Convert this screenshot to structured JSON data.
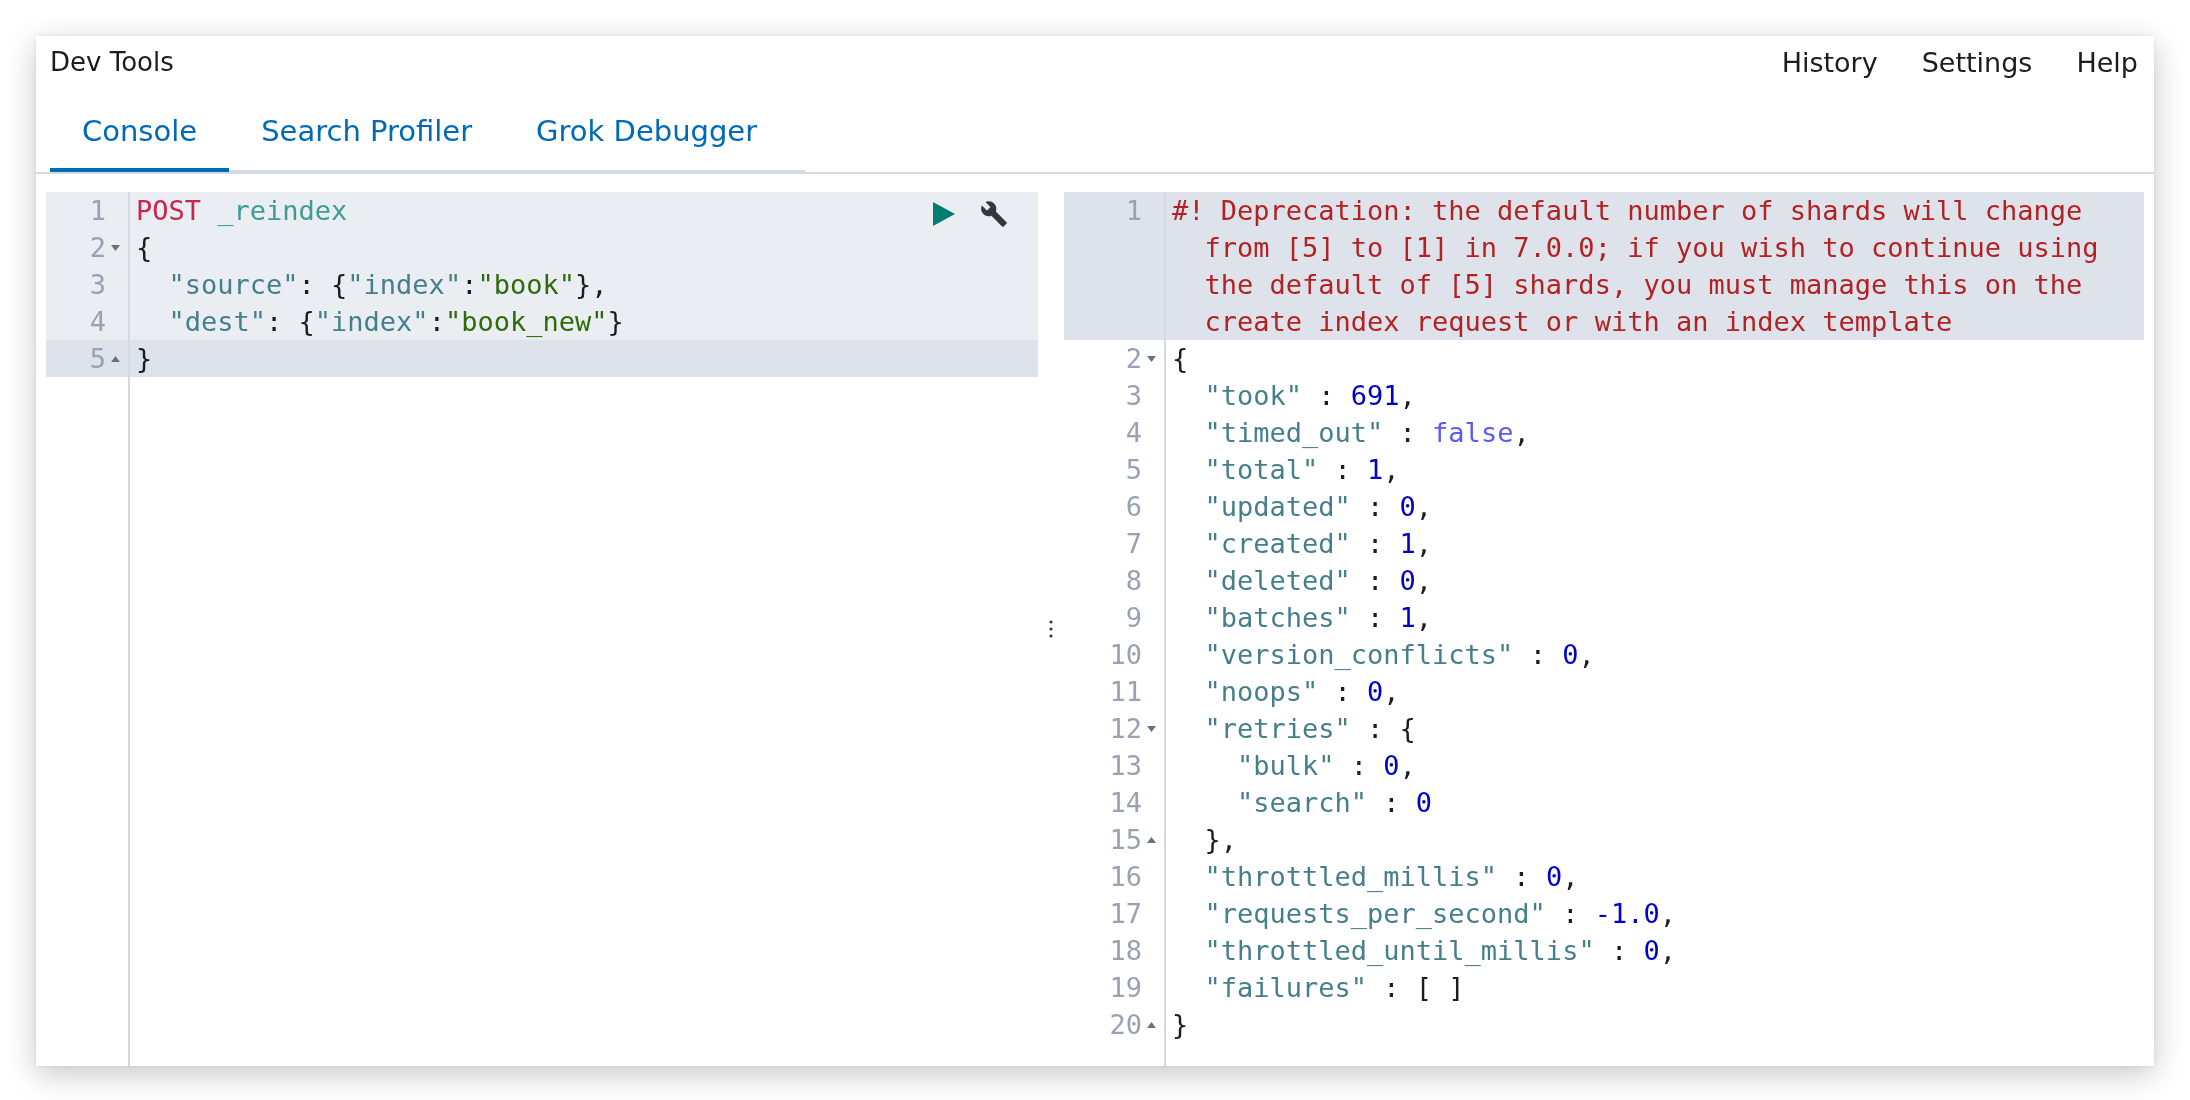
{
  "header": {
    "title": "Dev Tools",
    "links": [
      "History",
      "Settings",
      "Help"
    ]
  },
  "tabs": [
    {
      "label": "Console",
      "selected": true
    },
    {
      "label": "Search Profiler",
      "selected": false
    },
    {
      "label": "Grok Debugger",
      "selected": false
    }
  ],
  "request_editor": {
    "lines": [
      {
        "number": "1",
        "fold_start": false,
        "fold_end": false,
        "highlighted": true,
        "active": false,
        "tokens": [
          {
            "kind": "method",
            "text": "POST"
          },
          {
            "kind": "url",
            "text": " _reindex"
          }
        ]
      },
      {
        "number": "2",
        "fold_start": true,
        "fold_end": false,
        "highlighted": true,
        "active": false,
        "tokens": [
          {
            "kind": "punct",
            "text": "{"
          }
        ]
      },
      {
        "number": "3",
        "fold_start": false,
        "fold_end": false,
        "highlighted": true,
        "active": false,
        "tokens": [
          {
            "kind": "key",
            "text": "  \"source\""
          },
          {
            "kind": "punct",
            "text": ": {"
          },
          {
            "kind": "key",
            "text": "\"index\""
          },
          {
            "kind": "punct",
            "text": ":"
          },
          {
            "kind": "string",
            "text": "\"book\""
          },
          {
            "kind": "punct",
            "text": "},"
          }
        ]
      },
      {
        "number": "4",
        "fold_start": false,
        "fold_end": false,
        "highlighted": true,
        "active": false,
        "tokens": [
          {
            "kind": "key",
            "text": "  \"dest\""
          },
          {
            "kind": "punct",
            "text": ": {"
          },
          {
            "kind": "key",
            "text": "\"index\""
          },
          {
            "kind": "punct",
            "text": ":"
          },
          {
            "kind": "string",
            "text": "\"book_new\""
          },
          {
            "kind": "punct",
            "text": "}"
          }
        ]
      },
      {
        "number": "5",
        "fold_start": false,
        "fold_end": true,
        "highlighted": true,
        "active": true,
        "tokens": [
          {
            "kind": "punct",
            "text": "}"
          }
        ]
      }
    ]
  },
  "response_editor": {
    "lines": [
      {
        "number": "1",
        "fold_start": false,
        "fold_end": false,
        "active": true,
        "tokens": [
          {
            "kind": "comment",
            "text": "#! Deprecation: the default number of shards will change from [5] to [1] in 7.0.0; if you wish to continue using the default of [5] shards, you must manage this on the create index request or with an index template"
          }
        ]
      },
      {
        "number": "2",
        "fold_start": true,
        "fold_end": false,
        "active": false,
        "tokens": [
          {
            "kind": "punct",
            "text": "{"
          }
        ]
      },
      {
        "number": "3",
        "fold_start": false,
        "fold_end": false,
        "active": false,
        "tokens": [
          {
            "kind": "key",
            "text": "  \"took\""
          },
          {
            "kind": "punct",
            "text": " : "
          },
          {
            "kind": "number",
            "text": "691"
          },
          {
            "kind": "punct",
            "text": ","
          }
        ]
      },
      {
        "number": "4",
        "fold_start": false,
        "fold_end": false,
        "active": false,
        "tokens": [
          {
            "kind": "key",
            "text": "  \"timed_out\""
          },
          {
            "kind": "punct",
            "text": " : "
          },
          {
            "kind": "boolean",
            "text": "false"
          },
          {
            "kind": "punct",
            "text": ","
          }
        ]
      },
      {
        "number": "5",
        "fold_start": false,
        "fold_end": false,
        "active": false,
        "tokens": [
          {
            "kind": "key",
            "text": "  \"total\""
          },
          {
            "kind": "punct",
            "text": " : "
          },
          {
            "kind": "number",
            "text": "1"
          },
          {
            "kind": "punct",
            "text": ","
          }
        ]
      },
      {
        "number": "6",
        "fold_start": false,
        "fold_end": false,
        "active": false,
        "tokens": [
          {
            "kind": "key",
            "text": "  \"updated\""
          },
          {
            "kind": "punct",
            "text": " : "
          },
          {
            "kind": "number",
            "text": "0"
          },
          {
            "kind": "punct",
            "text": ","
          }
        ]
      },
      {
        "number": "7",
        "fold_start": false,
        "fold_end": false,
        "active": false,
        "tokens": [
          {
            "kind": "key",
            "text": "  \"created\""
          },
          {
            "kind": "punct",
            "text": " : "
          },
          {
            "kind": "number",
            "text": "1"
          },
          {
            "kind": "punct",
            "text": ","
          }
        ]
      },
      {
        "number": "8",
        "fold_start": false,
        "fold_end": false,
        "active": false,
        "tokens": [
          {
            "kind": "key",
            "text": "  \"deleted\""
          },
          {
            "kind": "punct",
            "text": " : "
          },
          {
            "kind": "number",
            "text": "0"
          },
          {
            "kind": "punct",
            "text": ","
          }
        ]
      },
      {
        "number": "9",
        "fold_start": false,
        "fold_end": false,
        "active": false,
        "tokens": [
          {
            "kind": "key",
            "text": "  \"batches\""
          },
          {
            "kind": "punct",
            "text": " : "
          },
          {
            "kind": "number",
            "text": "1"
          },
          {
            "kind": "punct",
            "text": ","
          }
        ]
      },
      {
        "number": "10",
        "fold_start": false,
        "fold_end": false,
        "active": false,
        "tokens": [
          {
            "kind": "key",
            "text": "  \"version_conflicts\""
          },
          {
            "kind": "punct",
            "text": " : "
          },
          {
            "kind": "number",
            "text": "0"
          },
          {
            "kind": "punct",
            "text": ","
          }
        ]
      },
      {
        "number": "11",
        "fold_start": false,
        "fold_end": false,
        "active": false,
        "tokens": [
          {
            "kind": "key",
            "text": "  \"noops\""
          },
          {
            "kind": "punct",
            "text": " : "
          },
          {
            "kind": "number",
            "text": "0"
          },
          {
            "kind": "punct",
            "text": ","
          }
        ]
      },
      {
        "number": "12",
        "fold_start": true,
        "fold_end": false,
        "active": false,
        "tokens": [
          {
            "kind": "key",
            "text": "  \"retries\""
          },
          {
            "kind": "punct",
            "text": " : {"
          }
        ]
      },
      {
        "number": "13",
        "fold_start": false,
        "fold_end": false,
        "active": false,
        "tokens": [
          {
            "kind": "key",
            "text": "    \"bulk\""
          },
          {
            "kind": "punct",
            "text": " : "
          },
          {
            "kind": "number",
            "text": "0"
          },
          {
            "kind": "punct",
            "text": ","
          }
        ]
      },
      {
        "number": "14",
        "fold_start": false,
        "fold_end": false,
        "active": false,
        "tokens": [
          {
            "kind": "key",
            "text": "    \"search\""
          },
          {
            "kind": "punct",
            "text": " : "
          },
          {
            "kind": "number",
            "text": "0"
          }
        ]
      },
      {
        "number": "15",
        "fold_start": false,
        "fold_end": true,
        "active": false,
        "tokens": [
          {
            "kind": "punct",
            "text": "  },"
          }
        ]
      },
      {
        "number": "16",
        "fold_start": false,
        "fold_end": false,
        "active": false,
        "tokens": [
          {
            "kind": "key",
            "text": "  \"throttled_millis\""
          },
          {
            "kind": "punct",
            "text": " : "
          },
          {
            "kind": "number",
            "text": "0"
          },
          {
            "kind": "punct",
            "text": ","
          }
        ]
      },
      {
        "number": "17",
        "fold_start": false,
        "fold_end": false,
        "active": false,
        "tokens": [
          {
            "kind": "key",
            "text": "  \"requests_per_second\""
          },
          {
            "kind": "punct",
            "text": " : "
          },
          {
            "kind": "number",
            "text": "-1.0"
          },
          {
            "kind": "punct",
            "text": ","
          }
        ]
      },
      {
        "number": "18",
        "fold_start": false,
        "fold_end": false,
        "active": false,
        "tokens": [
          {
            "kind": "key",
            "text": "  \"throttled_until_millis\""
          },
          {
            "kind": "punct",
            "text": " : "
          },
          {
            "kind": "number",
            "text": "0"
          },
          {
            "kind": "punct",
            "text": ","
          }
        ]
      },
      {
        "number": "19",
        "fold_start": false,
        "fold_end": false,
        "active": false,
        "tokens": [
          {
            "kind": "key",
            "text": "  \"failures\""
          },
          {
            "kind": "punct",
            "text": " : [ ]"
          }
        ]
      },
      {
        "number": "20",
        "fold_start": false,
        "fold_end": true,
        "active": false,
        "tokens": [
          {
            "kind": "punct",
            "text": "}"
          }
        ]
      }
    ]
  }
}
